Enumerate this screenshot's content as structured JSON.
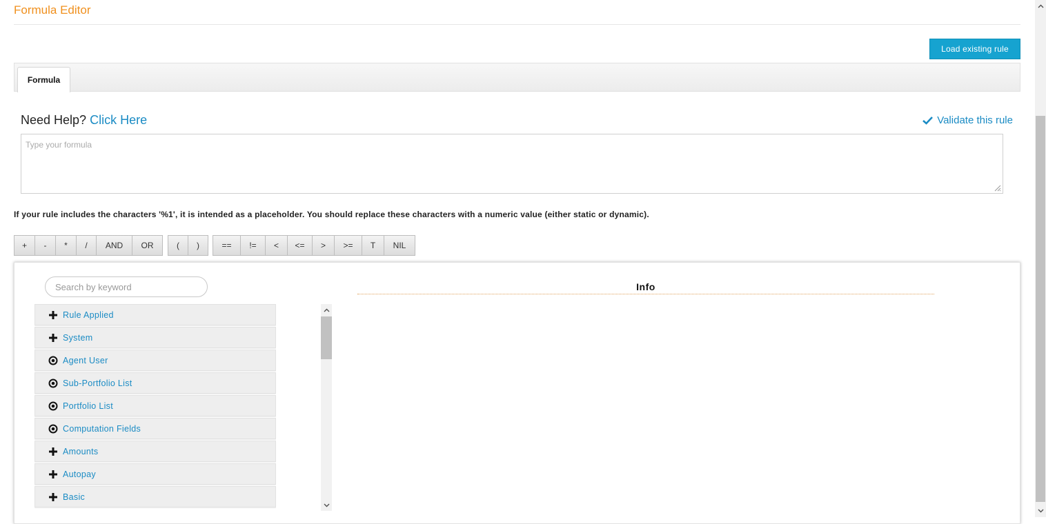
{
  "page": {
    "title": "Formula Editor",
    "load_button": "Load existing rule"
  },
  "tabs": [
    {
      "label": "Formula",
      "active": true
    }
  ],
  "help": {
    "prefix": "Need Help?",
    "link": "Click Here",
    "validate": "Validate this rule"
  },
  "formula": {
    "placeholder": "Type your formula",
    "value": ""
  },
  "note": "If your rule includes the characters '%1', it is intended as a placeholder. You should replace these characters with a numeric value (either static or dynamic).",
  "operators": {
    "arithmetic": [
      "+",
      "-",
      "*",
      "/",
      "AND",
      "OR"
    ],
    "parens": [
      "(",
      ")"
    ],
    "comparison": [
      "==",
      "!=",
      "<",
      "<=",
      ">",
      ">=",
      "T",
      "NIL"
    ]
  },
  "search": {
    "placeholder": "Search by keyword"
  },
  "info": {
    "title": "Info"
  },
  "tree": [
    {
      "label": "Rule Applied",
      "icon": "plus-icon"
    },
    {
      "label": "System",
      "icon": "plus-icon"
    },
    {
      "label": "Agent User",
      "icon": "radio-icon"
    },
    {
      "label": "Sub-Portfolio List",
      "icon": "radio-icon"
    },
    {
      "label": "Portfolio List",
      "icon": "radio-icon"
    },
    {
      "label": "Computation Fields",
      "icon": "radio-icon"
    },
    {
      "label": "Amounts",
      "icon": "plus-icon"
    },
    {
      "label": "Autopay",
      "icon": "plus-icon"
    },
    {
      "label": "Basic",
      "icon": "plus-icon"
    }
  ],
  "colors": {
    "title": "#f0901e",
    "accent": "#16a3d0",
    "link": "#1a8bc4"
  }
}
